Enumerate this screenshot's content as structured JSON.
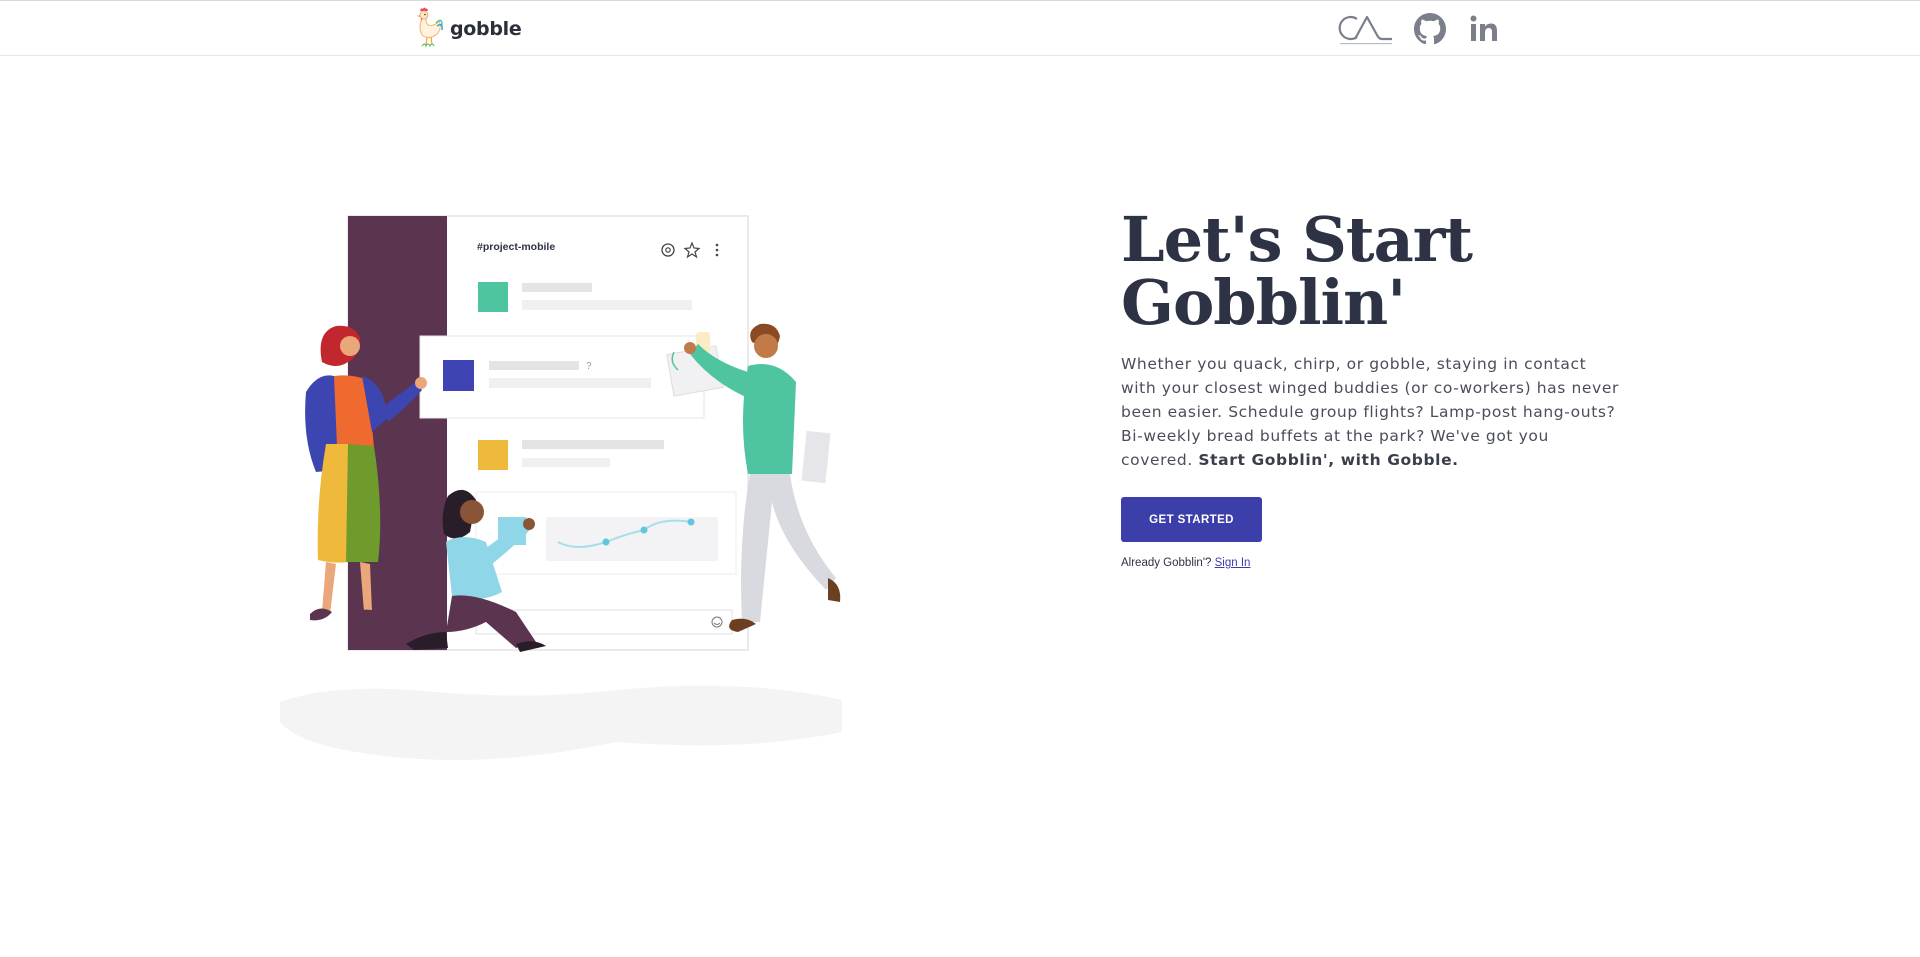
{
  "brand": {
    "name": "gobble",
    "logo_icon": "rooster-icon"
  },
  "nav": {
    "icons": [
      {
        "name": "portfolio-logo-icon",
        "label": "CA"
      },
      {
        "name": "github-icon"
      },
      {
        "name": "linkedin-icon"
      }
    ]
  },
  "illustration": {
    "channel_name": "#project-mobile",
    "question_mark": "?",
    "sidebar_color": "#5b3450",
    "tile_colors": [
      "#4fc4a0",
      "#3f44b4",
      "#efb93c"
    ]
  },
  "hero": {
    "headline": "Let's Start Gobblin'",
    "description": "Whether you quack, chirp, or gobble, staying in contact with your closest winged buddies (or co-workers) has never been easier. Schedule group flights? Lamp-post hang-outs? Bi-weekly bread buffets at the park? We've got you covered.",
    "tagline": "Start Gobblin', with Gobble.",
    "cta_label": "GET STARTED",
    "signin_prompt": "Already Gobblin'?",
    "signin_link": "Sign In"
  },
  "colors": {
    "accent": "#3c3faa",
    "heading": "#2d3245"
  }
}
